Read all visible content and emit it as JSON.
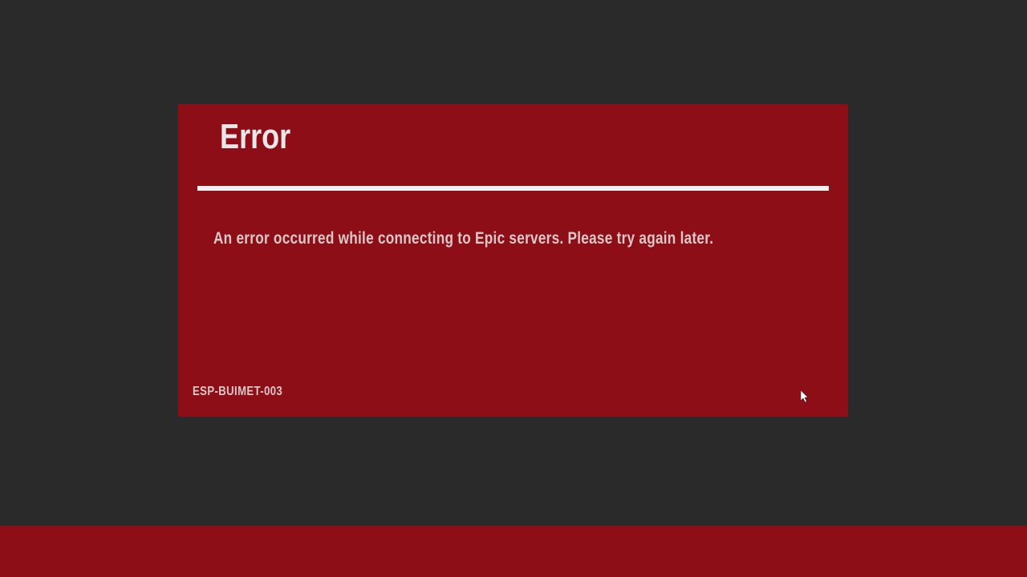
{
  "dialog": {
    "title": "Error",
    "message": "An error occurred while connecting to Epic servers. Please try again later.",
    "code": "ESP-BUIMET-003"
  },
  "colors": {
    "background": "#2a2a2a",
    "dialog_bg": "#8e0e18",
    "text_primary": "#e8e8e8",
    "text_secondary": "#d8c8c8",
    "divider": "#f0f0f0"
  }
}
